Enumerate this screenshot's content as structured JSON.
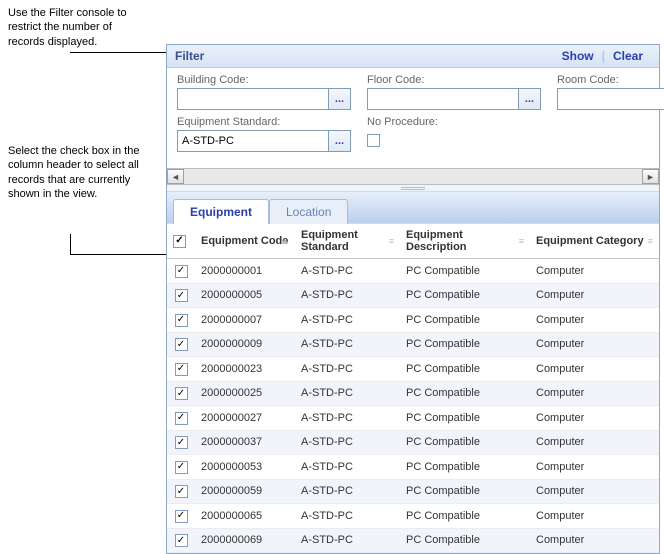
{
  "annotations": {
    "filter_note": "Use the Filter console to restrict the number of records displayed.",
    "checkbox_note": "Select the check box in the column header to select all records that are currently shown in the view."
  },
  "filter": {
    "title": "Filter",
    "show": "Show",
    "clear": "Clear",
    "building_code_label": "Building Code:",
    "building_code_value": "",
    "floor_code_label": "Floor Code:",
    "floor_code_value": "",
    "room_code_label": "Room Code:",
    "room_code_value": "",
    "equipment_standard_label": "Equipment Standard:",
    "equipment_standard_value": "A-STD-PC",
    "no_procedure_label": "No Procedure:",
    "lookup_glyph": "..."
  },
  "tabs": {
    "equipment": "Equipment",
    "location": "Location"
  },
  "grid": {
    "headers": {
      "code": "Equipment Code",
      "standard": "Equipment Standard",
      "description": "Equipment Description",
      "category": "Equipment Category"
    },
    "rows": [
      {
        "checked": true,
        "code": "2000000001",
        "standard": "A-STD-PC",
        "description": "PC Compatible",
        "category": "Computer"
      },
      {
        "checked": true,
        "code": "2000000005",
        "standard": "A-STD-PC",
        "description": "PC Compatible",
        "category": "Computer"
      },
      {
        "checked": true,
        "code": "2000000007",
        "standard": "A-STD-PC",
        "description": "PC Compatible",
        "category": "Computer"
      },
      {
        "checked": true,
        "code": "2000000009",
        "standard": "A-STD-PC",
        "description": "PC Compatible",
        "category": "Computer"
      },
      {
        "checked": true,
        "code": "2000000023",
        "standard": "A-STD-PC",
        "description": "PC Compatible",
        "category": "Computer"
      },
      {
        "checked": true,
        "code": "2000000025",
        "standard": "A-STD-PC",
        "description": "PC Compatible",
        "category": "Computer"
      },
      {
        "checked": true,
        "code": "2000000027",
        "standard": "A-STD-PC",
        "description": "PC Compatible",
        "category": "Computer"
      },
      {
        "checked": true,
        "code": "2000000037",
        "standard": "A-STD-PC",
        "description": "PC Compatible",
        "category": "Computer"
      },
      {
        "checked": true,
        "code": "2000000053",
        "standard": "A-STD-PC",
        "description": "PC Compatible",
        "category": "Computer"
      },
      {
        "checked": true,
        "code": "2000000059",
        "standard": "A-STD-PC",
        "description": "PC Compatible",
        "category": "Computer"
      },
      {
        "checked": true,
        "code": "2000000065",
        "standard": "A-STD-PC",
        "description": "PC Compatible",
        "category": "Computer"
      },
      {
        "checked": true,
        "code": "2000000069",
        "standard": "A-STD-PC",
        "description": "PC Compatible",
        "category": "Computer"
      }
    ]
  }
}
